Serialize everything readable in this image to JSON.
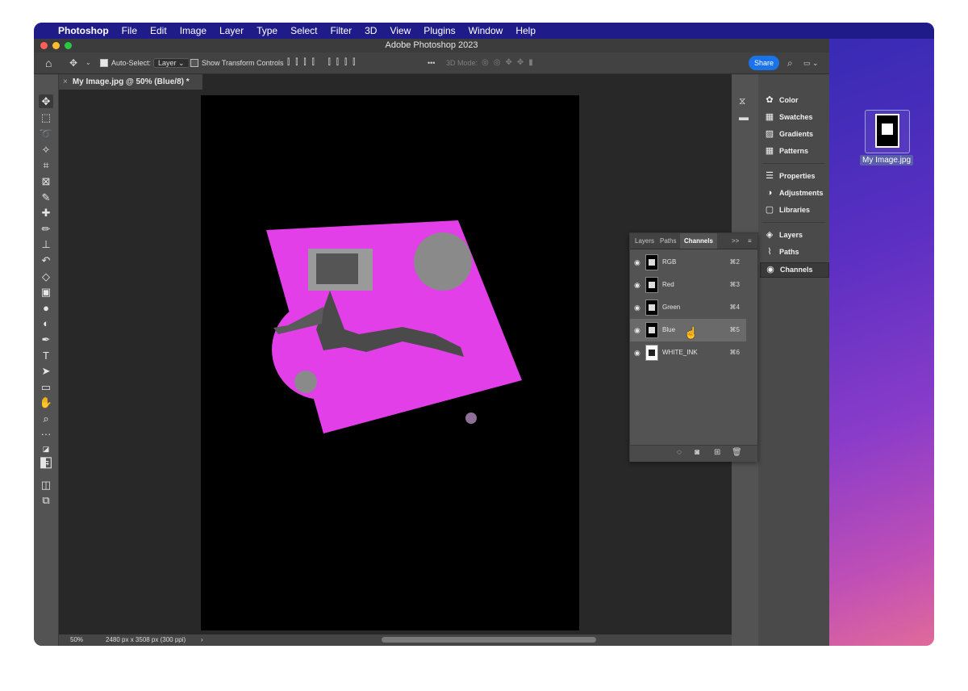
{
  "menubar": {
    "app": "Photoshop",
    "items": [
      "File",
      "Edit",
      "Image",
      "Layer",
      "Type",
      "Select",
      "Filter",
      "3D",
      "View",
      "Plugins",
      "Window",
      "Help"
    ]
  },
  "window": {
    "title": "Adobe Photoshop 2023"
  },
  "options_bar": {
    "auto_select_label": "Auto-Select:",
    "auto_select_value": "Layer",
    "show_transform_label": "Show Transform Controls",
    "mode_3d_label": "3D Mode:",
    "share_label": "Share",
    "more_label": "•••"
  },
  "document": {
    "tab_title": "My Image.jpg @ 50% (Blue/8) *",
    "zoom": "50%",
    "dimensions": "2480 px x 3508 px (300 ppi)",
    "status_arrow": "›"
  },
  "right_panels": [
    {
      "icon": "color-icon",
      "label": "Color"
    },
    {
      "icon": "swatches-icon",
      "label": "Swatches"
    },
    {
      "icon": "gradients-icon",
      "label": "Gradients"
    },
    {
      "icon": "patterns-icon",
      "label": "Patterns"
    },
    {
      "icon": "properties-icon",
      "label": "Properties"
    },
    {
      "icon": "adjustments-icon",
      "label": "Adjustments"
    },
    {
      "icon": "libraries-icon",
      "label": "Libraries"
    },
    {
      "icon": "layers-icon",
      "label": "Layers"
    },
    {
      "icon": "paths-icon",
      "label": "Paths"
    },
    {
      "icon": "channels-icon",
      "label": "Channels"
    }
  ],
  "channels_panel": {
    "tabs": [
      "Layers",
      "Paths",
      "Channels"
    ],
    "active_tab": "Channels",
    "expand": ">>",
    "channels": [
      {
        "name": "RGB",
        "shortcut": "⌘2"
      },
      {
        "name": "Red",
        "shortcut": "⌘3"
      },
      {
        "name": "Green",
        "shortcut": "⌘4"
      },
      {
        "name": "Blue",
        "shortcut": "⌘5"
      },
      {
        "name": "WHITE_INK",
        "shortcut": "⌘6"
      }
    ],
    "selected": "Blue"
  },
  "desktop": {
    "file_label": "My Image.jpg"
  },
  "colors": {
    "magenta": "#e23fe8",
    "ps_bg": "#535353",
    "share_blue": "#1a73e8"
  }
}
